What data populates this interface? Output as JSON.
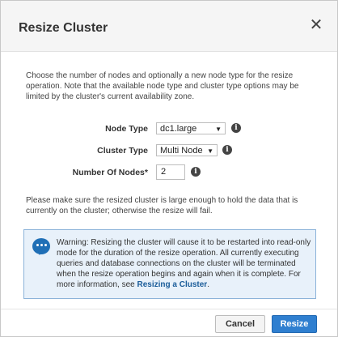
{
  "dialog": {
    "title": "Resize Cluster",
    "close_icon": "close-icon",
    "close_glyph": "✕",
    "intro": "Choose the number of nodes and optionally a new node type for the resize operation. Note that the available node type and cluster type options may be limited by the cluster's current availability zone."
  },
  "form": {
    "node_type_label": "Node Type",
    "node_type_value": "dc1.large",
    "cluster_type_label": "Cluster Type",
    "cluster_type_value": "Multi Node",
    "num_nodes_label": "Number Of Nodes*",
    "num_nodes_value": "2",
    "info_glyph": "i",
    "caret_glyph": "▼"
  },
  "note": "Please make sure the resized cluster is large enough to hold the data that is currently on the cluster; otherwise the resize will fail.",
  "warning": {
    "icon": "speech-bubble-info-icon",
    "text": "Warning: Resizing the cluster will cause it to be restarted into read-only mode for the duration of the resize operation. All currently executing queries and database connections on the cluster will be terminated when the resize operation begins and again when it is complete. For more information, see ",
    "link": "Resizing a Cluster",
    "end": "."
  },
  "buttons": {
    "cancel": "Cancel",
    "resize": "Resize"
  },
  "colors": {
    "primary": "#2f7fd0",
    "warning_bg": "#e8f1fa",
    "warning_border": "#8cb3d9"
  }
}
